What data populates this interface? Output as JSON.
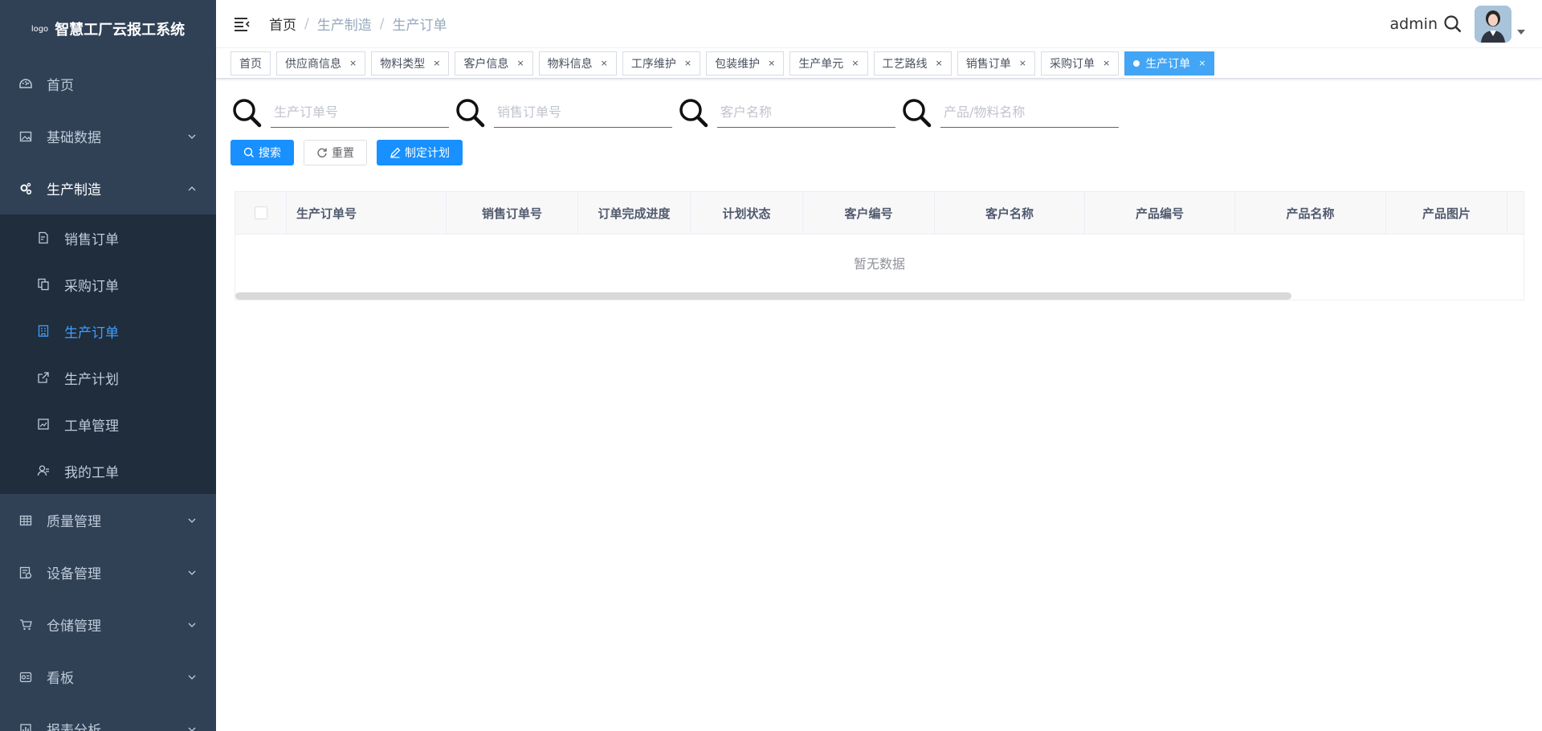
{
  "app": {
    "logo_mark": "logo",
    "title": "智慧工厂云报工系统"
  },
  "sidebar": {
    "top_items": [
      {
        "label": "首页"
      },
      {
        "label": "基础数据"
      },
      {
        "label": "生产制造"
      }
    ],
    "sub_items": [
      {
        "label": "销售订单"
      },
      {
        "label": "采购订单"
      },
      {
        "label": "生产订单"
      },
      {
        "label": "生产计划"
      },
      {
        "label": "工单管理"
      },
      {
        "label": "我的工单"
      }
    ],
    "bottom_items": [
      {
        "label": "质量管理"
      },
      {
        "label": "设备管理"
      },
      {
        "label": "仓储管理"
      },
      {
        "label": "看板"
      },
      {
        "label": "报表分析"
      }
    ]
  },
  "navbar": {
    "breadcrumb": [
      "首页",
      "生产制造",
      "生产订单"
    ],
    "username": "admin"
  },
  "tags": [
    "首页",
    "供应商信息",
    "物料类型",
    "客户信息",
    "物料信息",
    "工序维护",
    "包装维护",
    "生产单元",
    "工艺路线",
    "销售订单",
    "采购订单",
    "生产订单"
  ],
  "tag_close": "×",
  "search": {
    "fields": [
      {
        "placeholder": "生产订单号"
      },
      {
        "placeholder": "销售订单号"
      },
      {
        "placeholder": "客户名称"
      },
      {
        "placeholder": "产品/物料名称"
      }
    ],
    "buttons": {
      "search": "搜索",
      "reset": "重置",
      "plan": "制定计划"
    }
  },
  "table": {
    "columns": [
      "生产订单号",
      "销售订单号",
      "订单完成进度",
      "计划状态",
      "客户编号",
      "客户名称",
      "产品编号",
      "产品名称",
      "产品图片"
    ],
    "empty_text": "暂无数据"
  },
  "colors": {
    "sidebar_bg": "#304156",
    "submenu_bg": "#1f2d3d",
    "accent": "#409eff",
    "primary_btn": "#1890ff",
    "active_tag": "#42a5f5"
  }
}
